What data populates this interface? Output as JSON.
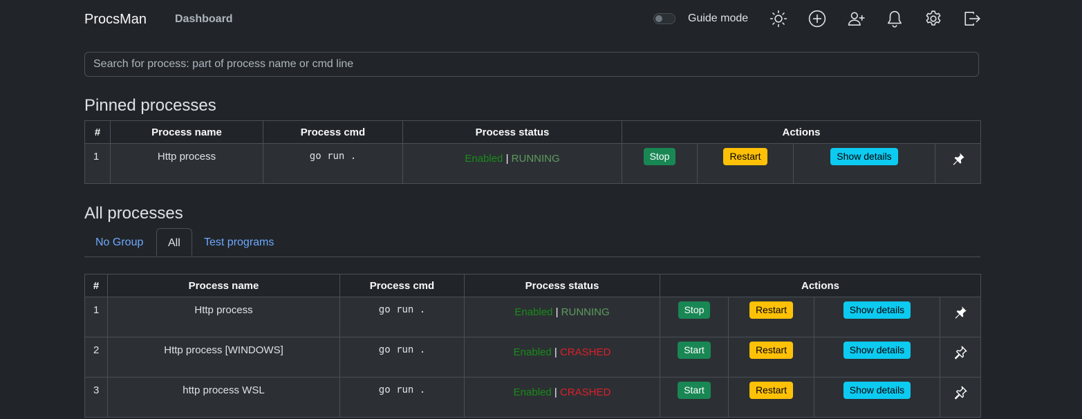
{
  "navbar": {
    "brand": "ProcsMan",
    "links": [
      "Dashboard"
    ],
    "guide_mode_label": "Guide mode",
    "guide_mode_on": false,
    "icons": [
      "sun-icon",
      "plus-circle-icon",
      "person-add-icon",
      "bell-icon",
      "gear-icon",
      "logout-icon"
    ]
  },
  "search": {
    "placeholder": "Search for process: part of process name or cmd line",
    "value": ""
  },
  "pinned": {
    "title": "Pinned processes",
    "headers": [
      "#",
      "Process name",
      "Process cmd",
      "Process status",
      "Actions"
    ],
    "rows": [
      {
        "idx": "1",
        "name": "Http process",
        "cmd": "go run .",
        "enabled": "Enabled",
        "sep": "|",
        "status": "RUNNING",
        "action": "Stop",
        "restart": "Restart",
        "details": "Show details",
        "pinned": true
      }
    ]
  },
  "all": {
    "title": "All processes",
    "tabs": [
      "No Group",
      "All",
      "Test programs"
    ],
    "active_tab": "All",
    "headers": [
      "#",
      "Process name",
      "Process cmd",
      "Process status",
      "Actions"
    ],
    "rows": [
      {
        "idx": "1",
        "name": "Http process",
        "cmd": "go run .",
        "enabled": "Enabled",
        "sep": "|",
        "status": "RUNNING",
        "action": "Stop",
        "restart": "Restart",
        "details": "Show details",
        "pinned": true
      },
      {
        "idx": "2",
        "name": "Http process [WINDOWS]",
        "cmd": "go run .",
        "enabled": "Enabled",
        "sep": "|",
        "status": "CRASHED",
        "action": "Start",
        "restart": "Restart",
        "details": "Show details",
        "pinned": false
      },
      {
        "idx": "3",
        "name": "http process WSL",
        "cmd": "go run .",
        "enabled": "Enabled",
        "sep": "|",
        "status": "CRASHED",
        "action": "Start",
        "restart": "Restart",
        "details": "Show details",
        "pinned": false
      }
    ]
  },
  "colors": {
    "background": "#212529",
    "enabled": "#198c19",
    "running": "#5f9a5f",
    "crashed": "#dc1f2a",
    "success": "#198754",
    "warning": "#ffc107",
    "info": "#0dcaf0",
    "link": "#6ea8fe"
  }
}
